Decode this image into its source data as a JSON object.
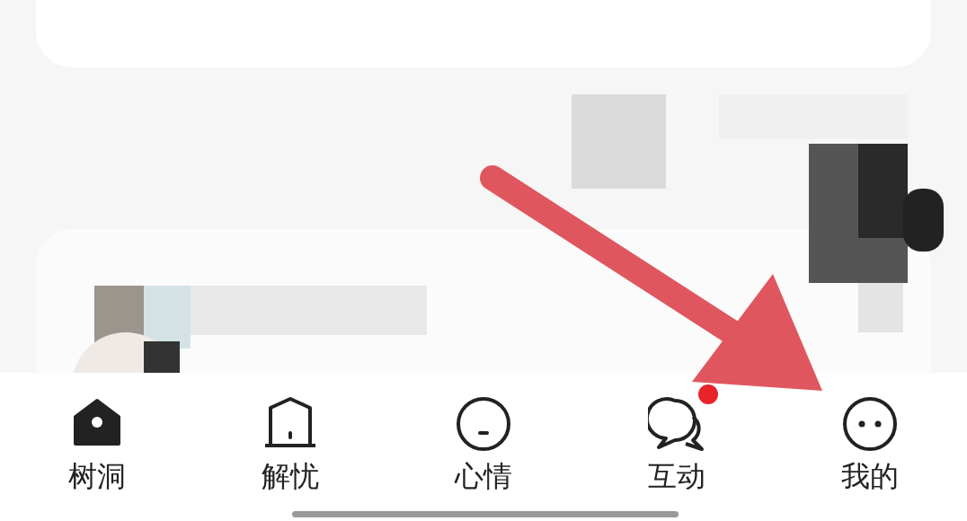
{
  "tab_bar": {
    "tabs": [
      {
        "label": "树洞",
        "kind": "house",
        "selected": true,
        "badge": false
      },
      {
        "label": "解忧",
        "kind": "door",
        "selected": false,
        "badge": false
      },
      {
        "label": "心情",
        "kind": "face-flat",
        "selected": false,
        "badge": false
      },
      {
        "label": "互动",
        "kind": "chat",
        "selected": false,
        "badge": true
      },
      {
        "label": "我的",
        "kind": "face-eyes",
        "selected": false,
        "badge": false
      }
    ]
  }
}
